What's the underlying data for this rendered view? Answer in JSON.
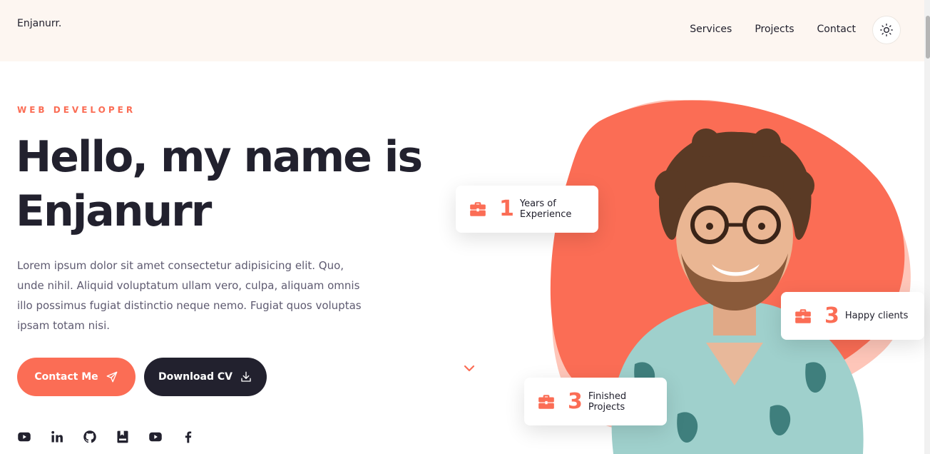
{
  "header": {
    "logo": "Enjanurr.",
    "nav": [
      "Services",
      "Projects",
      "Contact"
    ]
  },
  "hero": {
    "eyebrow": "WEB DEVELOPER",
    "headline_line1": "Hello, my name is",
    "headline_line2": "Enjanurr",
    "intro": "Lorem ipsum dolor sit amet consectetur adipisicing elit. Quo, unde nihil. Aliquid voluptatum ullam vero, culpa, aliquam omnis illo possimus fugiat distinctio neque nemo. Fugiat quos voluptas ipsam totam nisi.",
    "contact_label": "Contact Me",
    "cv_label": "Download CV"
  },
  "socials": [
    "youtube-icon",
    "linkedin-icon",
    "github-icon",
    "bookmark-icon",
    "youtube-icon",
    "facebook-icon"
  ],
  "stats": {
    "years": {
      "number": "1",
      "label": "Years of Experience"
    },
    "clients": {
      "number": "3",
      "label": "Happy clients"
    },
    "projects": {
      "number": "3",
      "label": "Finished Projects"
    }
  },
  "colors": {
    "accent": "#fb6d55",
    "dark": "#22212e",
    "header_bg": "#fdf6f1"
  }
}
